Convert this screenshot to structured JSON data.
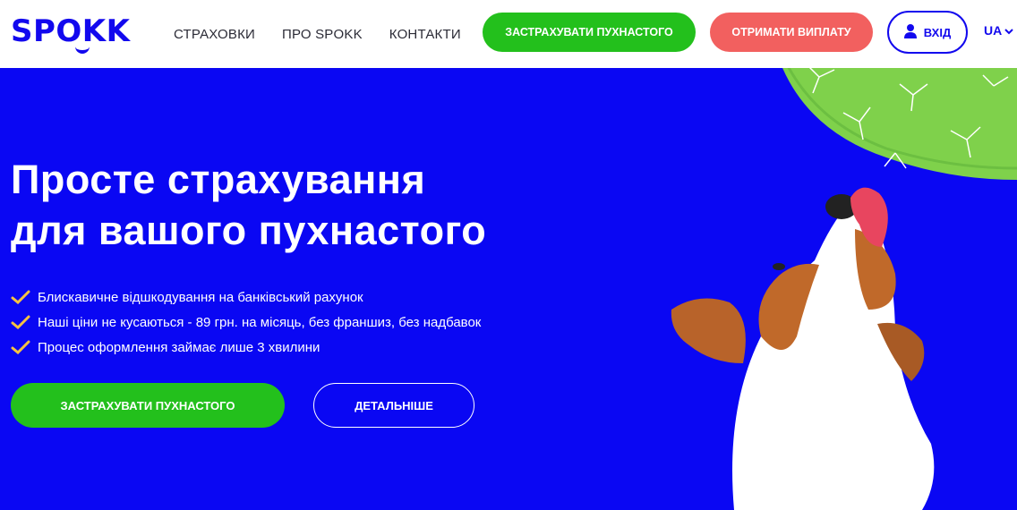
{
  "header": {
    "logo": "SPOKK",
    "nav": [
      {
        "label": "СТРАХОВКИ"
      },
      {
        "label": "ПРО SPOKK"
      },
      {
        "label": "КОНТАКТИ"
      }
    ],
    "insure_button": "ЗАСТРАХУВАТИ ПУХНАСТОГО",
    "payout_button": "ОТРИМАТИ ВИПЛАТУ",
    "login_button": "ВХІД",
    "language": "UA"
  },
  "hero": {
    "title_line1": "Просте страхування",
    "title_line2": "для вашого пухнастого",
    "benefits": [
      "Блискавичне відшкодування на банківський рахунок",
      "Наші ціни не кусаються - 89 грн. на місяць, без франшиз, без надбавок",
      "Процес оформлення займає лише 3 хвилини"
    ],
    "insure_button": "ЗАСТРАХУВАТИ ПУХНАСТОГО",
    "details_button": "ДЕТАЛЬНІШЕ"
  },
  "colors": {
    "brand_blue": "#0a07f3",
    "green": "#23c01c",
    "coral": "#f2605f",
    "check_yellow": "#f5c242"
  },
  "icons": {
    "user": "user-icon",
    "chevron": "chevron-down-icon",
    "check": "check-icon"
  }
}
